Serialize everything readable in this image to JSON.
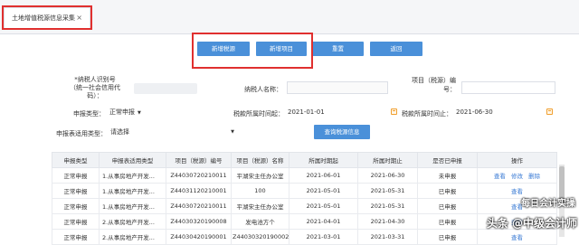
{
  "tab": {
    "label": "土地增值税源信息采集",
    "close": "×"
  },
  "toolbar": {
    "add_tax_source": "新增税源",
    "add_project": "新增项目",
    "reset": "重置",
    "back": "返回"
  },
  "form": {
    "taxpayer_id_label_1": "*纳税人识别号",
    "taxpayer_id_label_2": "（统一社会信用代",
    "taxpayer_id_label_3": "码）：",
    "taxpayer_name_label": "纳税人名称：",
    "project_code_label_1": "项目（税源）编",
    "project_code_label_2": "号：",
    "declare_type_label": "申报类型：",
    "declare_type_value": "正常申报",
    "period_start_label": "税款所属时间起：",
    "period_start_value": "2021-01-01",
    "period_end_label": "税款所属时间止：",
    "period_end_value": "2021-06-30",
    "usage_type_label": "申报表适用类型：",
    "usage_type_value": "请选择",
    "query_button": "查询税源信息"
  },
  "table": {
    "headers": [
      "申报类型",
      "申报表适用类型",
      "项目（税源）编号",
      "项目（税源）名称",
      "所属时期起",
      "所属时期止",
      "是否已申报",
      "操作"
    ],
    "rows": [
      [
        "正常申报",
        "1.从事房地产开发...",
        "Z44030720210011",
        "平湖宋主任办公室",
        "2021-06-01",
        "2021-06-30",
        "未申报",
        "查看 修改 删除"
      ],
      [
        "正常申报",
        "1.从事房地产开发...",
        "Z44031120210001",
        "100",
        "2021-05-01",
        "2021-05-31",
        "已申报",
        "查看"
      ],
      [
        "正常申报",
        "1.从事房地产开发...",
        "Z44030720210011",
        "平湖宋主任办公室",
        "2021-05-01",
        "2021-05-31",
        "已申报",
        "查看"
      ],
      [
        "正常申报",
        "2.从事房地产开发...",
        "Z44030320190008",
        "发电池方个",
        "2021-04-01",
        "2021-04-30",
        "已申报",
        "查看"
      ],
      [
        "正常申报",
        "2.从事房地产开发...",
        "Z44030420190001",
        "Z44030320190002",
        "2021-03-01",
        "2021-03-31",
        "已申报",
        "查看"
      ]
    ],
    "action_view": "查看",
    "action_edit": "修改",
    "action_delete": "删除"
  },
  "watermark": {
    "line1": "每日会计实操",
    "line2": "头条 @中级会计师"
  },
  "colors": {
    "accent": "#4a90d9",
    "highlight": "#e0302f",
    "link": "#3a7bd5"
  }
}
